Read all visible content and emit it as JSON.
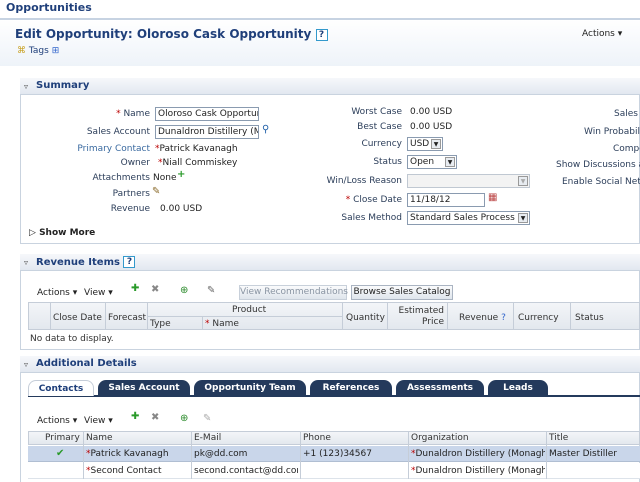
{
  "app": {
    "title": "Opportunities"
  },
  "header": {
    "title": "Edit Opportunity: Oloroso Cask Opportunity",
    "help": "?",
    "actions_label": "Actions",
    "tags_label": "Tags"
  },
  "summary": {
    "section_title": "Summary",
    "name_label": "Name",
    "name_value": "Oloroso Cask Opportunit",
    "sales_account_label": "Sales Account",
    "sales_account_value": "Dunaldron Distillery (Mon",
    "primary_contact_label": "Primary Contact",
    "primary_contact_value": "Patrick Kavanagh",
    "owner_label": "Owner",
    "owner_value": "Niall Commiskey",
    "attachments_label": "Attachments",
    "attachments_value": "None",
    "partners_label": "Partners",
    "revenue_label": "Revenue",
    "revenue_value": "0.00",
    "revenue_currency": "USD",
    "worst_case_label": "Worst Case",
    "worst_case_value": "0.00",
    "worst_case_currency": "USD",
    "best_case_label": "Best Case",
    "best_case_value": "0.00",
    "best_case_currency": "USD",
    "currency_label": "Currency",
    "currency_value": "USD",
    "status_label": "Status",
    "status_value": "Open",
    "win_loss_label": "Win/Loss Reason",
    "win_loss_value": "",
    "close_date_label": "Close Date",
    "close_date_value": "11/18/12",
    "sales_method_label": "Sales Method",
    "sales_method_value": "Standard Sales Process",
    "right_col": [
      "Sales S",
      "Win Probabilit",
      "Compe",
      "Show Discussions and",
      "Enable Social Netwo"
    ],
    "show_more": "Show More"
  },
  "revenue_items": {
    "section_title": "Revenue Items",
    "actions_label": "Actions",
    "view_label": "View",
    "view_recommendations": "View Recommendations",
    "browse_catalog": "Browse Sales Catalog",
    "columns": {
      "close_date": "Close Date",
      "forecast": "Forecast",
      "product": "Product",
      "type": "Type",
      "name": "Name",
      "quantity": "Quantity",
      "est_price": "Estimated Price",
      "revenue": "Revenue",
      "currency": "Currency",
      "status": "Status"
    },
    "empty_text": "No data to display."
  },
  "additional": {
    "section_title": "Additional Details",
    "tabs": [
      "Contacts",
      "Sales Account",
      "Opportunity Team",
      "References",
      "Assessments",
      "Leads"
    ],
    "actions_label": "Actions",
    "view_label": "View",
    "columns": [
      "Primary",
      "Name",
      "E-Mail",
      "Phone",
      "Organization",
      "Title"
    ],
    "rows": [
      {
        "primary": true,
        "name": "Patrick Kavanagh",
        "email": "pk@dd.com",
        "phone": "+1 (123)34567",
        "org": "Dunaldron Distillery (Monaghan, I",
        "title": "Master Distiller"
      },
      {
        "primary": false,
        "name": "Second Contact",
        "email": "second.contact@dd.com",
        "phone": "",
        "org": "Dunaldron Distillery (Monaghan, I",
        "title": ""
      }
    ]
  },
  "colors": {
    "title_blue": "#1f3f7a",
    "tab_dark": "#243a5c",
    "selected_row": "#c9d6ea"
  }
}
